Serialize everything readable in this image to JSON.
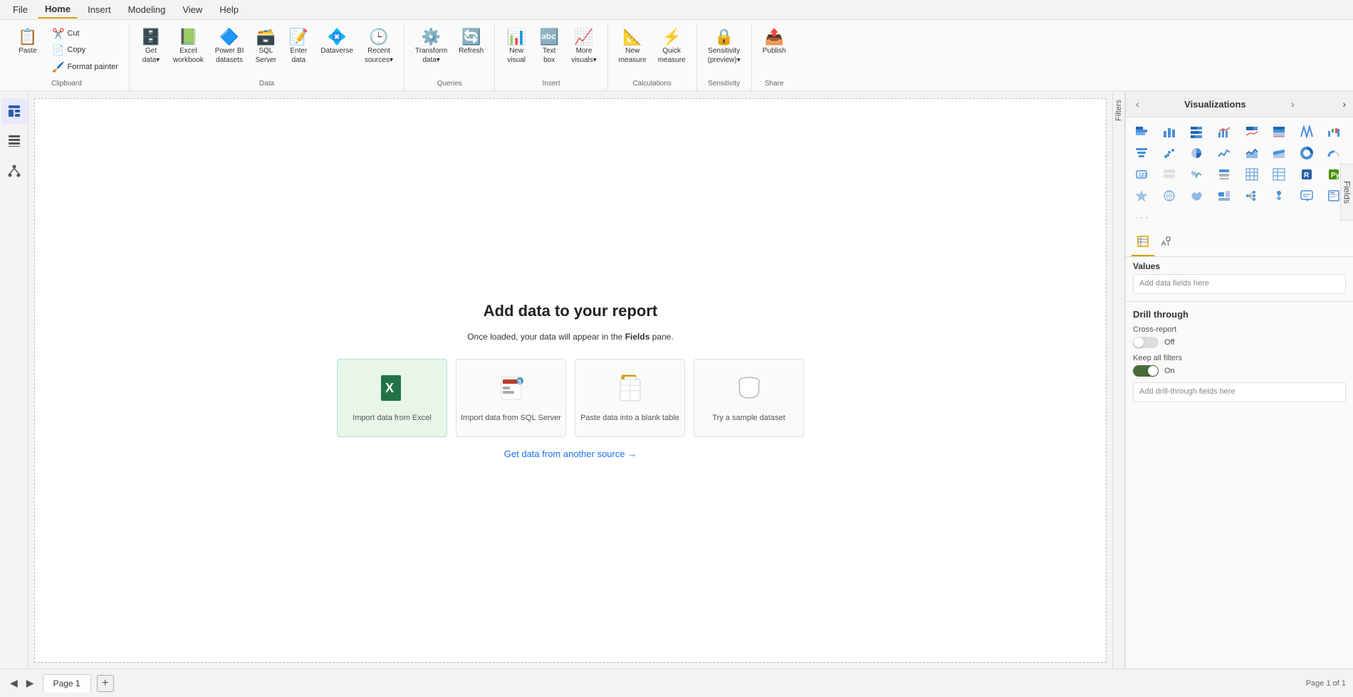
{
  "menu": {
    "items": [
      {
        "label": "File",
        "active": false
      },
      {
        "label": "Home",
        "active": true
      },
      {
        "label": "Insert",
        "active": false
      },
      {
        "label": "Modeling",
        "active": false
      },
      {
        "label": "View",
        "active": false
      },
      {
        "label": "Help",
        "active": false
      }
    ]
  },
  "ribbon": {
    "groups": [
      {
        "label": "Clipboard",
        "items_column": [
          {
            "id": "paste",
            "label": "Paste",
            "icon": "📋",
            "large": true
          },
          {
            "id": "cut",
            "label": "Cut",
            "icon": "✂️"
          },
          {
            "id": "copy",
            "label": "Copy",
            "icon": "📄"
          },
          {
            "id": "format-painter",
            "label": "Format painter",
            "icon": "🖌️"
          }
        ]
      },
      {
        "label": "Data",
        "items": [
          {
            "id": "get-data",
            "label": "Get data",
            "icon": "🗄️",
            "dropdown": true
          },
          {
            "id": "excel-workbook",
            "label": "Excel workbook",
            "icon": "📗"
          },
          {
            "id": "power-bi-datasets",
            "label": "Power BI datasets",
            "icon": "🔷"
          },
          {
            "id": "sql-server",
            "label": "SQL Server",
            "icon": "🗃️"
          },
          {
            "id": "enter-data",
            "label": "Enter data",
            "icon": "📝"
          },
          {
            "id": "dataverse",
            "label": "Dataverse",
            "icon": "💠"
          },
          {
            "id": "recent-sources",
            "label": "Recent sources",
            "icon": "🕒",
            "dropdown": true
          }
        ]
      },
      {
        "label": "Queries",
        "items": [
          {
            "id": "transform-data",
            "label": "Transform data",
            "icon": "⚙️",
            "dropdown": true
          },
          {
            "id": "refresh",
            "label": "Refresh",
            "icon": "🔄"
          }
        ]
      },
      {
        "label": "Insert",
        "items": [
          {
            "id": "new-visual",
            "label": "New visual",
            "icon": "📊"
          },
          {
            "id": "text-box",
            "label": "Text box",
            "icon": "🔤"
          },
          {
            "id": "more-visuals",
            "label": "More visuals",
            "icon": "📈",
            "dropdown": true
          }
        ]
      },
      {
        "label": "Calculations",
        "items": [
          {
            "id": "new-measure",
            "label": "New measure",
            "icon": "📐"
          },
          {
            "id": "quick-measure",
            "label": "Quick measure",
            "icon": "⚡"
          }
        ]
      },
      {
        "label": "Sensitivity",
        "items": [
          {
            "id": "sensitivity",
            "label": "Sensitivity (preview)",
            "icon": "🔒",
            "dropdown": true
          }
        ]
      },
      {
        "label": "Share",
        "items": [
          {
            "id": "publish",
            "label": "Publish",
            "icon": "📤"
          }
        ]
      }
    ]
  },
  "canvas": {
    "title": "Add data to your report",
    "subtitle_start": "Once loaded, your data will appear in the ",
    "subtitle_bold": "Fields",
    "subtitle_end": " pane.",
    "cards": [
      {
        "id": "import-excel",
        "icon": "📗",
        "label": "Import data from Excel",
        "highlighted": true
      },
      {
        "id": "import-sql",
        "icon": "🗃️",
        "label": "Import data from SQL Server",
        "highlighted": false
      },
      {
        "id": "paste-table",
        "icon": "📋",
        "label": "Paste data into a blank table",
        "highlighted": false
      },
      {
        "id": "sample-dataset",
        "icon": "🗄️",
        "label": "Try a sample dataset",
        "highlighted": false
      }
    ],
    "get_data_link": "Get data from another source →"
  },
  "visualizations": {
    "panel_title": "Visualizations",
    "expand_left": "‹",
    "expand_right": "›",
    "viz_icons": [
      "▦",
      "📊",
      "≡",
      "📈",
      "〒",
      "📊",
      "📉",
      "📊",
      "〰️",
      "◇",
      "〜",
      "📊",
      "📊",
      "📊",
      "🕐",
      "⬤",
      "▦",
      "📊",
      "%",
      "≋",
      "🌳",
      "🗺️",
      "🔷",
      "📊",
      "▦",
      "▦",
      "🅁",
      "🐍",
      "📊",
      "📊",
      "📊",
      "◇",
      "⧉",
      "💬",
      "📊",
      "📊",
      "🔑",
      "◇",
      "…",
      ""
    ],
    "tabs": [
      {
        "id": "fields-tab",
        "icon": "▦",
        "active": true
      },
      {
        "id": "format-tab",
        "icon": "🎨",
        "active": false
      }
    ],
    "values_label": "Values",
    "values_placeholder": "Add data fields here",
    "drill_through": {
      "title": "Drill through",
      "cross_report_label": "Cross-report",
      "cross_report_value": "Off",
      "cross_report_on": false,
      "keep_filters_label": "Keep all filters",
      "keep_filters_value": "On",
      "keep_filters_on": true,
      "dropzone_placeholder": "Add drill-through fields here"
    }
  },
  "status": {
    "page_label": "Page 1",
    "page_status": "Page 1 of 1"
  },
  "fields_panel": {
    "label": "Fields"
  }
}
